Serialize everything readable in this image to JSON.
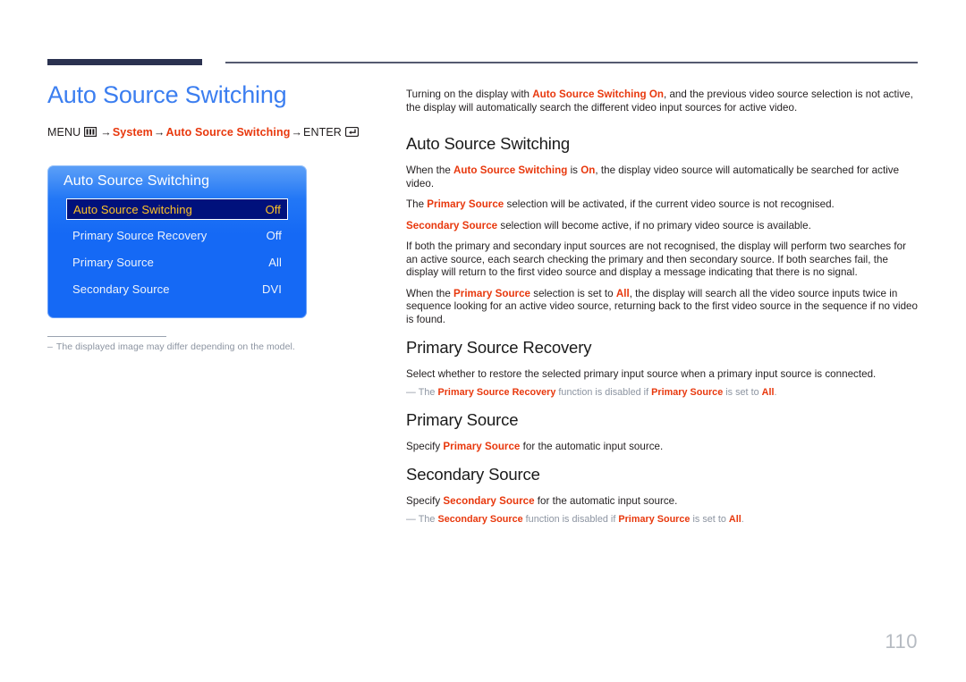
{
  "page": {
    "title": "Auto Source Switching",
    "number": "110",
    "accent_blue": "#3b7ef0",
    "accent_red": "#e8380d",
    "rule_navy": "#2b3250"
  },
  "menu_path": {
    "root_label": "MENU",
    "menu_icon": "menu-grid-icon",
    "arrow": "→",
    "steps": [
      "System",
      "Auto Source Switching"
    ],
    "enter_label": "ENTER",
    "enter_icon": "enter-key-icon"
  },
  "osd": {
    "title": "Auto Source Switching",
    "selected_index": 0,
    "highlight_bg": "#00117c",
    "highlight_text": "#ffc425",
    "panel_blue": "#1569f5",
    "rows": [
      {
        "label": "Auto Source Switching",
        "value": "Off"
      },
      {
        "label": "Primary Source Recovery",
        "value": "Off"
      },
      {
        "label": "Primary Source",
        "value": "All"
      },
      {
        "label": "Secondary Source",
        "value": "DVI"
      }
    ],
    "note": {
      "dash": "–",
      "text": "The displayed image may differ depending on the model."
    }
  },
  "content": {
    "intro": {
      "p1_a": "Turning on the display with ",
      "p1_hl": "Auto Source Switching On",
      "p1_b": ", and the previous video source selection is not active, the display will automatically search the different video input sources for active video."
    },
    "sections": [
      {
        "heading": "Auto Source Switching",
        "paragraphs": [
          {
            "parts": [
              {
                "t": "When the ",
                "hl": false
              },
              {
                "t": "Auto Source Switching",
                "hl": true
              },
              {
                "t": " is ",
                "hl": false
              },
              {
                "t": "On",
                "hl": true
              },
              {
                "t": ", the display video source will automatically be searched for active video.",
                "hl": false
              }
            ]
          },
          {
            "parts": [
              {
                "t": "The ",
                "hl": false
              },
              {
                "t": "Primary Source",
                "hl": true
              },
              {
                "t": " selection will be activated, if the current video source is not recognised.",
                "hl": false
              }
            ]
          },
          {
            "parts": [
              {
                "t": "Secondary Source",
                "hl": true
              },
              {
                "t": " selection will become active, if no primary video source is available.",
                "hl": false
              }
            ]
          },
          {
            "parts": [
              {
                "t": "If both the primary and secondary input sources are not recognised, the display will perform two searches for an active source, each search checking the primary and then secondary source. If both searches fail, the display will return to the first video source and display a message indicating that there is no signal.",
                "hl": false
              }
            ]
          },
          {
            "parts": [
              {
                "t": "When the ",
                "hl": false
              },
              {
                "t": "Primary Source",
                "hl": true
              },
              {
                "t": " selection is set to ",
                "hl": false
              },
              {
                "t": "All",
                "hl": true
              },
              {
                "t": ", the display will search all the video source inputs twice in sequence looking for an active video source, returning back to the first video source in the sequence if no video is found.",
                "hl": false
              }
            ]
          }
        ],
        "notes": []
      },
      {
        "heading": "Primary Source Recovery",
        "paragraphs": [
          {
            "parts": [
              {
                "t": "Select whether to restore the selected primary input source when a primary input source is connected.",
                "hl": false
              }
            ]
          }
        ],
        "notes": [
          {
            "dash": "—",
            "parts": [
              {
                "t": "The ",
                "hl": false
              },
              {
                "t": "Primary Source Recovery",
                "hl": true
              },
              {
                "t": " function is disabled if ",
                "hl": false
              },
              {
                "t": "Primary Source",
                "hl": true
              },
              {
                "t": " is set to ",
                "hl": false
              },
              {
                "t": "All",
                "hl": true
              },
              {
                "t": ".",
                "hl": false
              }
            ]
          }
        ]
      },
      {
        "heading": "Primary Source",
        "paragraphs": [
          {
            "parts": [
              {
                "t": "Specify ",
                "hl": false
              },
              {
                "t": "Primary Source",
                "hl": true
              },
              {
                "t": " for the automatic input source.",
                "hl": false
              }
            ]
          }
        ],
        "notes": []
      },
      {
        "heading": "Secondary Source",
        "paragraphs": [
          {
            "parts": [
              {
                "t": "Specify ",
                "hl": false
              },
              {
                "t": "Secondary Source",
                "hl": true
              },
              {
                "t": " for the automatic input source.",
                "hl": false
              }
            ]
          }
        ],
        "notes": [
          {
            "dash": "—",
            "parts": [
              {
                "t": "The ",
                "hl": false
              },
              {
                "t": "Secondary Source",
                "hl": true
              },
              {
                "t": " function is disabled if ",
                "hl": false
              },
              {
                "t": "Primary Source",
                "hl": true
              },
              {
                "t": " is set to ",
                "hl": false
              },
              {
                "t": "All",
                "hl": true
              },
              {
                "t": ".",
                "hl": false
              }
            ]
          }
        ]
      }
    ]
  }
}
